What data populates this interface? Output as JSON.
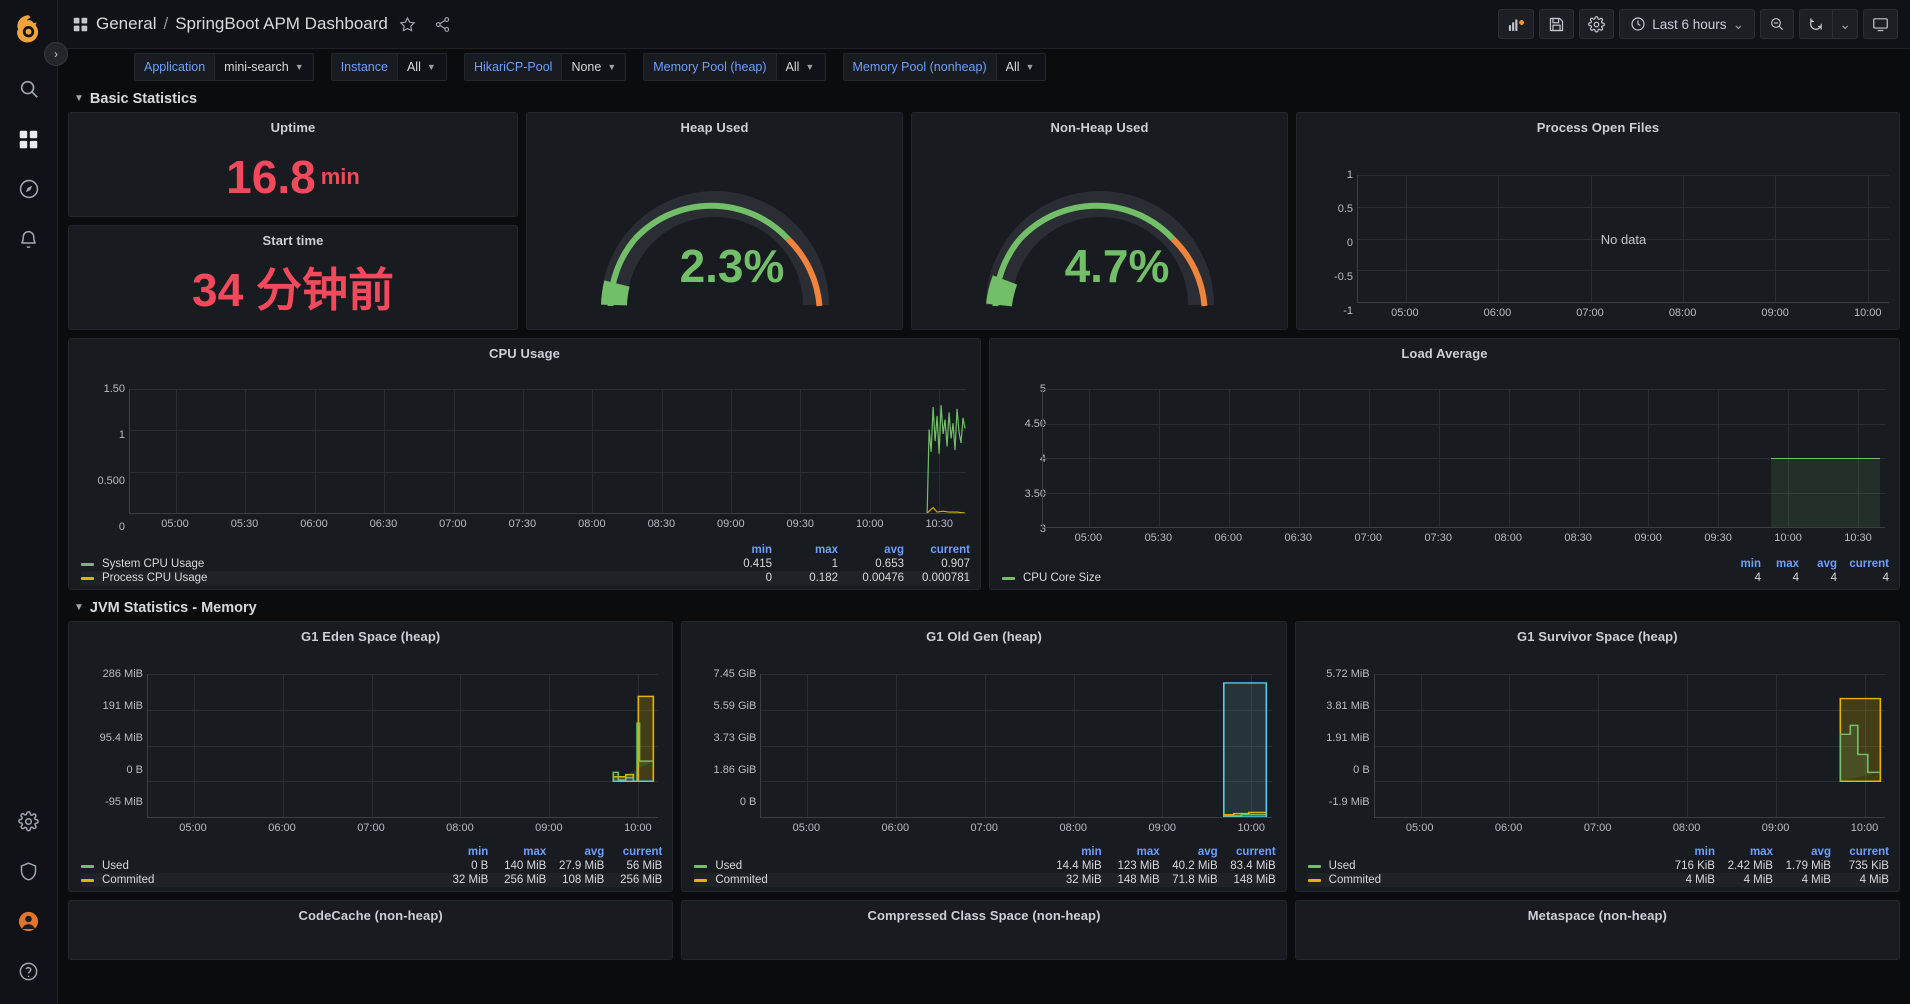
{
  "sidebar": {
    "items": [
      {
        "name": "grafana-logo-icon",
        "label": "Grafana"
      },
      {
        "name": "search-icon",
        "label": "Search"
      },
      {
        "name": "dashboards-icon",
        "label": "Dashboards"
      },
      {
        "name": "explore-icon",
        "label": "Explore"
      },
      {
        "name": "alerting-bell-icon",
        "label": "Alerting"
      },
      {
        "name": "configuration-gear-icon",
        "label": "Configuration"
      },
      {
        "name": "shield-icon",
        "label": "Server Admin"
      },
      {
        "name": "user-avatar-icon",
        "label": "Profile"
      },
      {
        "name": "help-icon",
        "label": "Help"
      }
    ],
    "expander_glyph": "›"
  },
  "topnav": {
    "dashboards_icon": "grid-icon",
    "folder": "General",
    "separator": "/",
    "title": "SpringBoot APM Dashboard",
    "star_glyph": "☆",
    "share_label": "share",
    "actions": [
      {
        "name": "add-panel-button",
        "label": "Add panel"
      },
      {
        "name": "save-dashboard-button",
        "label": "Save dashboard"
      },
      {
        "name": "dashboard-settings-button",
        "label": "Dashboard settings"
      }
    ],
    "time_range": "Last 6 hours",
    "time_chevron": "⌄",
    "zoom_out_label": "Zoom out time range",
    "refresh_label": "Refresh dashboard",
    "refresh_chevron": "⌄",
    "kiosk_label": "Cycle view mode"
  },
  "variables": [
    {
      "label": "Application",
      "value": "mini-search",
      "name": "variable-application"
    },
    {
      "label": "Instance",
      "value": "All",
      "name": "variable-instance"
    },
    {
      "label": "HikariCP-Pool",
      "value": "None",
      "name": "variable-hikaricp-pool"
    },
    {
      "label": "Memory Pool (heap)",
      "value": "All",
      "name": "variable-memory-pool-heap"
    },
    {
      "label": "Memory Pool (nonheap)",
      "value": "All",
      "name": "variable-memory-pool-nonheap"
    }
  ],
  "rows": [
    {
      "title": "Basic Statistics",
      "collapsed": false
    },
    {
      "title": "JVM Statistics - Memory",
      "collapsed": false
    }
  ],
  "panels": {
    "uptime": {
      "title": "Uptime",
      "value": "16.8",
      "unit": "min",
      "color": "#f2495c"
    },
    "start_time": {
      "title": "Start time",
      "value": "34 分钟前",
      "color": "#f2495c"
    },
    "heap_used": {
      "title": "Heap Used",
      "value": "2.3%",
      "percent": 2.3,
      "color": "#73bf69"
    },
    "nonheap_used": {
      "title": "Non-Heap Used",
      "value": "4.7%",
      "percent": 4.7,
      "color": "#73bf69"
    },
    "process_open_files": {
      "title": "Process Open Files",
      "no_data": "No data",
      "yticks": [
        "1",
        "0.5",
        "0",
        "-0.5",
        "-1"
      ],
      "xticks": [
        "05:00",
        "06:00",
        "07:00",
        "08:00",
        "09:00",
        "10:00"
      ]
    },
    "cpu_usage": {
      "title": "CPU Usage",
      "yticks": [
        "1.50",
        "1",
        "0.500",
        "0"
      ],
      "xticks": [
        "05:00",
        "05:30",
        "06:00",
        "06:30",
        "07:00",
        "07:30",
        "08:00",
        "08:30",
        "09:00",
        "09:30",
        "10:00",
        "10:30"
      ],
      "legend_headers": [
        "min",
        "max",
        "avg",
        "current"
      ],
      "series": [
        {
          "name": "System CPU Usage",
          "color": "#73bf69",
          "min": "0.415",
          "max": "1",
          "avg": "0.653",
          "current": "0.907"
        },
        {
          "name": "Process CPU Usage",
          "color": "#e0b400",
          "min": "0",
          "max": "0.182",
          "avg": "0.00476",
          "current": "0.000781"
        }
      ]
    },
    "load_average": {
      "title": "Load Average",
      "yticks": [
        "5",
        "4.50",
        "4",
        "3.50",
        "3"
      ],
      "xticks": [
        "05:00",
        "05:30",
        "06:00",
        "06:30",
        "07:00",
        "07:30",
        "08:00",
        "08:30",
        "09:00",
        "09:30",
        "10:00",
        "10:30"
      ],
      "legend_headers": [
        "min",
        "max",
        "avg",
        "current"
      ],
      "series": [
        {
          "name": "CPU Core Size",
          "color": "#73bf69",
          "min": "4",
          "max": "4",
          "avg": "4",
          "current": "4"
        }
      ]
    },
    "g1_eden": {
      "title": "G1 Eden Space (heap)",
      "yticks": [
        "286 MiB",
        "191 MiB",
        "95.4 MiB",
        "0 B",
        "-95 MiB"
      ],
      "xticks": [
        "05:00",
        "06:00",
        "07:00",
        "08:00",
        "09:00",
        "10:00"
      ],
      "legend_headers": [
        "min",
        "max",
        "avg",
        "current"
      ],
      "series": [
        {
          "name": "Used",
          "color": "#73bf69",
          "min": "0 B",
          "max": "140 MiB",
          "avg": "27.9 MiB",
          "current": "56 MiB"
        },
        {
          "name": "Commited",
          "color": "#e0b400",
          "min": "32 MiB",
          "max": "256 MiB",
          "avg": "108 MiB",
          "current": "256 MiB"
        }
      ]
    },
    "g1_old_gen": {
      "title": "G1 Old Gen (heap)",
      "yticks": [
        "7.45 GiB",
        "5.59 GiB",
        "3.73 GiB",
        "1.86 GiB",
        "0 B"
      ],
      "xticks": [
        "05:00",
        "06:00",
        "07:00",
        "08:00",
        "09:00",
        "10:00"
      ],
      "legend_headers": [
        "min",
        "max",
        "avg",
        "current"
      ],
      "series": [
        {
          "name": "Used",
          "color": "#73bf69",
          "min": "14.4 MiB",
          "max": "123 MiB",
          "avg": "40.2 MiB",
          "current": "83.4 MiB"
        },
        {
          "name": "Commited",
          "color": "#e0b400",
          "min": "32 MiB",
          "max": "148 MiB",
          "avg": "71.8 MiB",
          "current": "148 MiB"
        }
      ]
    },
    "g1_survivor": {
      "title": "G1 Survivor Space (heap)",
      "yticks": [
        "5.72 MiB",
        "3.81 MiB",
        "1.91 MiB",
        "0 B",
        "-1.9 MiB"
      ],
      "xticks": [
        "05:00",
        "06:00",
        "07:00",
        "08:00",
        "09:00",
        "10:00"
      ],
      "legend_headers": [
        "min",
        "max",
        "avg",
        "current"
      ],
      "series": [
        {
          "name": "Used",
          "color": "#73bf69",
          "min": "716 KiB",
          "max": "2.42 MiB",
          "avg": "1.79 MiB",
          "current": "735 KiB"
        },
        {
          "name": "Commited",
          "color": "#e0b400",
          "min": "4 MiB",
          "max": "4 MiB",
          "avg": "4 MiB",
          "current": "4 MiB"
        }
      ]
    },
    "codecache": {
      "title": "CodeCache (non-heap)"
    },
    "compressed_class": {
      "title": "Compressed Class Space (non-heap)"
    },
    "metaspace": {
      "title": "Metaspace (non-heap)"
    }
  },
  "chart_data": [
    {
      "type": "line",
      "title": "Process Open Files",
      "xlabel": "",
      "ylabel": "",
      "ylim": [
        -1,
        1
      ],
      "grid": true,
      "xticks": [
        "05:00",
        "06:00",
        "07:00",
        "08:00",
        "09:00",
        "10:00"
      ],
      "yticks": [
        -1,
        -0.5,
        0,
        0.5,
        1
      ],
      "series": [],
      "annotation": "No data"
    },
    {
      "type": "line",
      "title": "CPU Usage",
      "xlabel": "",
      "ylabel": "",
      "ylim": [
        0,
        1.5
      ],
      "grid": true,
      "xticks": [
        "05:00",
        "05:30",
        "06:00",
        "06:30",
        "07:00",
        "07:30",
        "08:00",
        "08:30",
        "09:00",
        "09:30",
        "10:00",
        "10:30"
      ],
      "yticks": [
        0,
        0.5,
        1,
        1.5
      ],
      "legend": "table-right",
      "series": [
        {
          "name": "System CPU Usage",
          "color": "#73bf69",
          "min": 0.415,
          "max": 1,
          "avg": 0.653,
          "current": 0.907,
          "x": [
            "10:05",
            "10:08",
            "10:11",
            "10:14",
            "10:17",
            "10:20",
            "10:23",
            "10:26",
            "10:29",
            "10:32",
            "10:35"
          ],
          "values": [
            0.63,
            0.92,
            0.55,
            0.8,
            0.47,
            0.88,
            0.6,
            1.0,
            0.52,
            0.74,
            0.907
          ]
        },
        {
          "name": "Process CPU Usage",
          "color": "#e0b400",
          "min": 0,
          "max": 0.182,
          "avg": 0.00476,
          "current": 0.000781,
          "x": [
            "10:05",
            "10:10",
            "10:15",
            "10:20",
            "10:25",
            "10:30",
            "10:35"
          ],
          "values": [
            0.002,
            0.182,
            0.004,
            0.001,
            0.003,
            0.001,
            0.000781
          ]
        }
      ]
    },
    {
      "type": "line",
      "title": "Load Average",
      "xlabel": "",
      "ylabel": "",
      "ylim": [
        3,
        5
      ],
      "grid": true,
      "xticks": [
        "05:00",
        "05:30",
        "06:00",
        "06:30",
        "07:00",
        "07:30",
        "08:00",
        "08:30",
        "09:00",
        "09:30",
        "10:00",
        "10:30"
      ],
      "yticks": [
        3,
        3.5,
        4,
        4.5,
        5
      ],
      "legend": "table-right",
      "series": [
        {
          "name": "CPU Core Size",
          "color": "#73bf69",
          "min": 4,
          "max": 4,
          "avg": 4,
          "current": 4,
          "x": [
            "10:05",
            "10:15",
            "10:25",
            "10:35"
          ],
          "values": [
            4,
            4,
            4,
            4
          ]
        }
      ]
    },
    {
      "type": "area",
      "title": "G1 Eden Space (heap)",
      "xlabel": "",
      "ylabel": "bytes",
      "ylim": [
        -99614720,
        299892736
      ],
      "grid": true,
      "xticks": [
        "05:00",
        "06:00",
        "07:00",
        "08:00",
        "09:00",
        "10:00"
      ],
      "yticks": [
        "-95 MiB",
        "0 B",
        "95.4 MiB",
        "191 MiB",
        "286 MiB"
      ],
      "legend": "table-right",
      "series": [
        {
          "name": "Used",
          "color": "#73bf69",
          "min": "0 B",
          "max": "140 MiB",
          "avg": "27.9 MiB",
          "current": "56 MiB",
          "x": [
            "10:06",
            "10:12",
            "10:18",
            "10:24",
            "10:30",
            "10:36"
          ],
          "values": [
            12,
            6,
            4,
            140,
            28,
            56
          ]
        },
        {
          "name": "Commited",
          "color": "#e0b400",
          "min": "32 MiB",
          "max": "256 MiB",
          "avg": "108 MiB",
          "current": "256 MiB",
          "x": [
            "10:06",
            "10:12",
            "10:18",
            "10:24",
            "10:30",
            "10:36"
          ],
          "values": [
            32,
            32,
            32,
            256,
            256,
            256
          ]
        }
      ]
    },
    {
      "type": "area",
      "title": "G1 Old Gen (heap)",
      "xlabel": "",
      "ylabel": "bytes",
      "ylim": [
        0,
        8000000000
      ],
      "grid": true,
      "xticks": [
        "05:00",
        "06:00",
        "07:00",
        "08:00",
        "09:00",
        "10:00"
      ],
      "yticks": [
        "0 B",
        "1.86 GiB",
        "3.73 GiB",
        "5.59 GiB",
        "7.45 GiB"
      ],
      "legend": "table-right",
      "series": [
        {
          "name": "Used",
          "color": "#73bf69",
          "min": "14.4 MiB",
          "max": "123 MiB",
          "avg": "40.2 MiB",
          "current": "83.4 MiB",
          "x": [
            "10:06",
            "10:18",
            "10:30",
            "10:36"
          ],
          "values": [
            14.4,
            123,
            40.2,
            83.4
          ]
        },
        {
          "name": "Commited",
          "color": "#e0b400",
          "min": "32 MiB",
          "max": "148 MiB",
          "avg": "71.8 MiB",
          "current": "148 MiB",
          "x": [
            "10:06",
            "10:18",
            "10:30",
            "10:36"
          ],
          "values": [
            32,
            148,
            71.8,
            148
          ]
        }
      ]
    },
    {
      "type": "area",
      "title": "G1 Survivor Space (heap)",
      "xlabel": "",
      "ylabel": "bytes",
      "ylim": [
        -1992294,
        5997854
      ],
      "grid": true,
      "xticks": [
        "05:00",
        "06:00",
        "07:00",
        "08:00",
        "09:00",
        "10:00"
      ],
      "yticks": [
        "-1.9 MiB",
        "0 B",
        "1.91 MiB",
        "3.81 MiB",
        "5.72 MiB"
      ],
      "legend": "table-right",
      "series": [
        {
          "name": "Used",
          "color": "#73bf69",
          "min": "716 KiB",
          "max": "2.42 MiB",
          "avg": "1.79 MiB",
          "current": "735 KiB",
          "x": [
            "10:06",
            "10:18",
            "10:30",
            "10:36"
          ],
          "values": [
            0.716,
            2.42,
            1.79,
            0.735
          ]
        },
        {
          "name": "Commited",
          "color": "#e0b400",
          "min": "4 MiB",
          "max": "4 MiB",
          "avg": "4 MiB",
          "current": "4 MiB",
          "x": [
            "10:06",
            "10:18",
            "10:30",
            "10:36"
          ],
          "values": [
            4,
            4,
            4,
            4
          ]
        }
      ]
    }
  ]
}
